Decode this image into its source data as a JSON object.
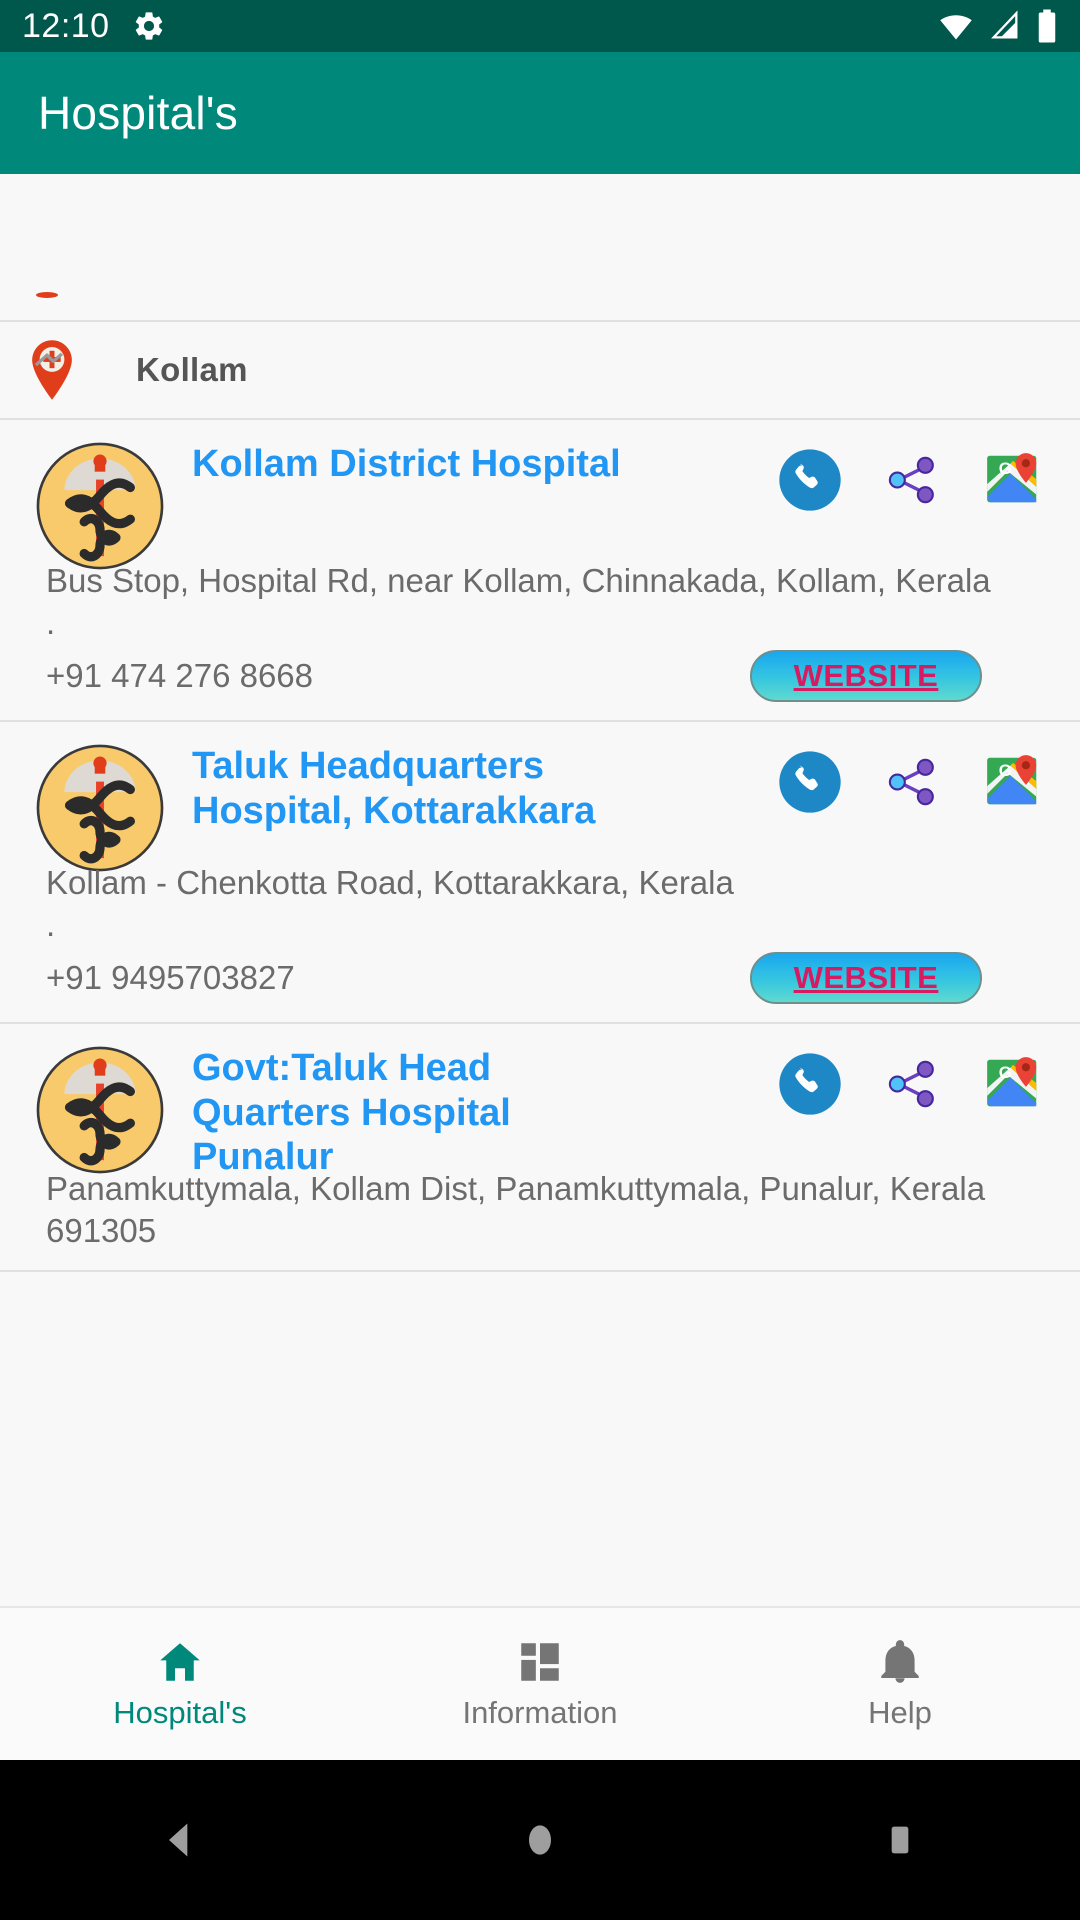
{
  "status_bar": {
    "time": "12:10",
    "icons": [
      "gear-icon",
      "wifi-icon",
      "cellular-signal-icon",
      "battery-icon"
    ],
    "background_color": "#00574B"
  },
  "app_bar": {
    "title": "Hospital's",
    "background_color": "#00897B",
    "text_color": "#FFFFFF"
  },
  "city_header": {
    "name": "Kollam",
    "icon": "hospital-map-pin-icon"
  },
  "hospitals": [
    {
      "name": "Kollam District Hospital",
      "address": "Bus Stop, Hospital Rd, near Kollam, Chinnakada, Kollam, Kerala",
      "separator": ".",
      "phone": "+91 474 276 8668",
      "website_label": "WEBSITE",
      "avatar_icon": "caduceus-hospital-icon",
      "actions": [
        "call-icon",
        "share-icon",
        "google-maps-icon"
      ]
    },
    {
      "name": "Taluk Headquarters Hospital, Kottarakkara",
      "address": "Kollam - Chenkotta Road, Kottarakkara, Kerala",
      "separator": ".",
      "phone": "+91 9495703827",
      "website_label": "WEBSITE",
      "avatar_icon": "caduceus-hospital-icon",
      "actions": [
        "call-icon",
        "share-icon",
        "google-maps-icon"
      ]
    },
    {
      "name": "Govt:Taluk Head Quarters Hospital Punalur",
      "address": "Panamkuttymala, Kollam Dist, Panamkuttymala, Punalur, Kerala 691305",
      "separator": "",
      "phone": "",
      "website_label": "",
      "avatar_icon": "caduceus-hospital-icon",
      "actions": [
        "call-icon",
        "share-icon",
        "google-maps-icon"
      ]
    }
  ],
  "bottom_nav": {
    "items": [
      {
        "label": "Hospital's",
        "icon": "home-icon",
        "active": true
      },
      {
        "label": "Information",
        "icon": "dashboard-grid-icon",
        "active": false
      },
      {
        "label": "Help",
        "icon": "bell-icon",
        "active": false
      }
    ],
    "active_color": "#00897B",
    "inactive_color": "#757575"
  },
  "system_nav": {
    "buttons": [
      "back-triangle-icon",
      "home-circle-icon",
      "recents-square-icon"
    ]
  },
  "colors": {
    "primary": "#00897B",
    "status_bar": "#00574B",
    "link_blue": "#2196F3",
    "body_text": "#6b6b6b",
    "website_text": "#d81b60"
  }
}
